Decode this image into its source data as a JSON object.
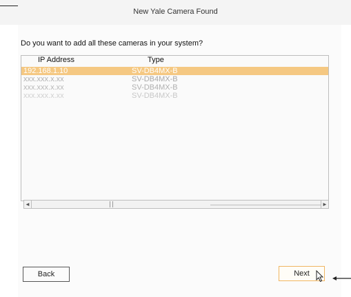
{
  "title": "New Yale Camera Found",
  "question": "Do you want to add all these cameras in your system?",
  "table": {
    "headers": {
      "ip": "IP Address",
      "type": "Type"
    },
    "rows": [
      {
        "ip": "192.168.1.10",
        "type": "SV-DB4MX-B",
        "selected": true
      },
      {
        "ip": "xxx.xxx.x.xx",
        "type": "SV-DB4MX-B",
        "selected": false
      },
      {
        "ip": "xxx.xxx.x.xx",
        "type": "SV-DB4MX-B",
        "selected": false
      },
      {
        "ip": "xxx.xxx.x.xx",
        "type": "SV-DB4MX-B",
        "selected": false
      }
    ]
  },
  "scrollbar": {
    "left_arrow": "◄",
    "right_arrow": "►"
  },
  "buttons": {
    "back": "Back",
    "next": "Next"
  },
  "colors": {
    "selection": "#f5c882",
    "next_border": "#f0b560"
  }
}
